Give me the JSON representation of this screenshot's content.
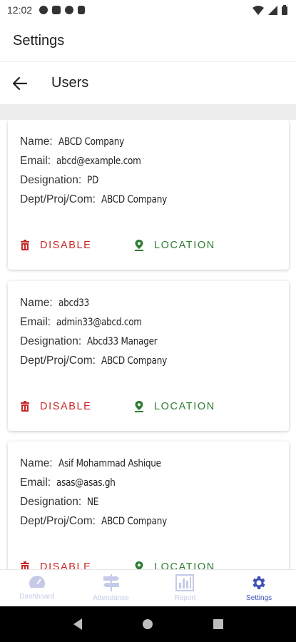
{
  "status_bar": {
    "time": "12:02"
  },
  "app_bar": {
    "title": "Settings"
  },
  "sub_header": {
    "title": "Users"
  },
  "users": [
    {
      "name_label": "Name:",
      "name": "ABCD Company",
      "email_label": "Email:",
      "email": "abcd@example.com",
      "designation_label": "Designation:",
      "designation": "PD",
      "dept_label": "Dept/Proj/Com:",
      "dept": "ABCD Company",
      "disable_label": "DISABLE",
      "location_label": "LOCATION"
    },
    {
      "name_label": "Name:",
      "name": "abcd33",
      "email_label": "Email:",
      "email": "admin33@abcd.com",
      "designation_label": "Designation:",
      "designation": "Abcd33 Manager",
      "dept_label": "Dept/Proj/Com:",
      "dept": "ABCD Company",
      "disable_label": "DISABLE",
      "location_label": "LOCATION"
    },
    {
      "name_label": "Name:",
      "name": "Asif Mohammad Ashique",
      "email_label": "Email:",
      "email": "asas@asas.gh",
      "designation_label": "Designation:",
      "designation": "NE",
      "dept_label": "Dept/Proj/Com:",
      "dept": "ABCD Company",
      "disable_label": "DISABLE",
      "location_label": "LOCATION"
    }
  ],
  "bottom_nav": {
    "items": [
      {
        "label": "Dashboard",
        "icon": "speedometer-icon",
        "active": false
      },
      {
        "label": "Attendance",
        "icon": "signpost-icon",
        "active": false
      },
      {
        "label": "Report",
        "icon": "bar-chart-icon",
        "active": false
      },
      {
        "label": "Settings",
        "icon": "gear-icon",
        "active": true
      }
    ]
  },
  "colors": {
    "disable": "#c62828",
    "location": "#2e7d32",
    "nav_active": "#3f51b5"
  }
}
